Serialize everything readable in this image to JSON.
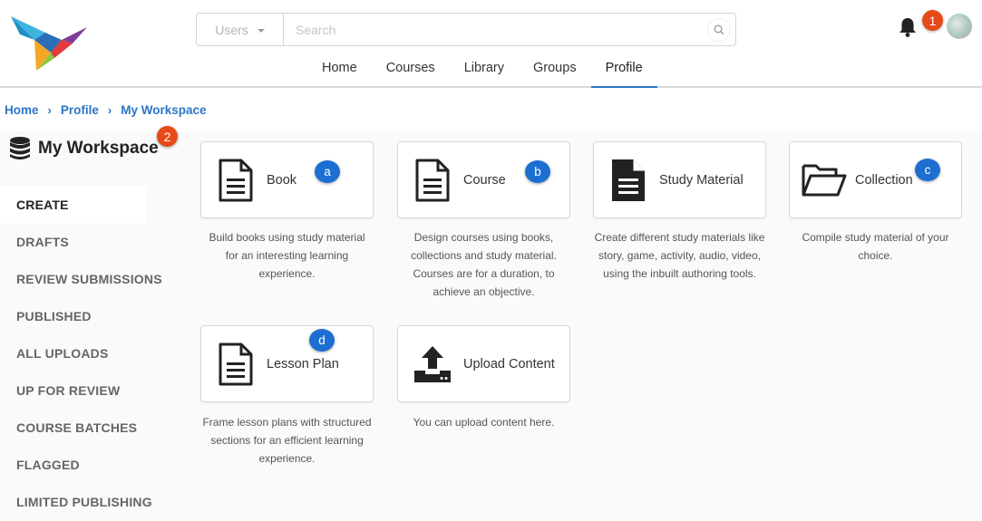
{
  "header": {
    "search_filter": "Users",
    "search_placeholder": "Search",
    "nav": [
      "Home",
      "Courses",
      "Library",
      "Groups",
      "Profile"
    ],
    "active_nav": "Profile",
    "notification_count_label": "1"
  },
  "breadcrumb": [
    "Home",
    "Profile",
    "My Workspace"
  ],
  "workspace": {
    "title": "My Workspace",
    "title_badge": "2",
    "menu": [
      "CREATE",
      "DRAFTS",
      "REVIEW SUBMISSIONS",
      "PUBLISHED",
      "ALL UPLOADS",
      "UP FOR REVIEW",
      "COURSE BATCHES",
      "FLAGGED",
      "LIMITED PUBLISHING"
    ],
    "active_menu": "CREATE"
  },
  "cards": [
    {
      "label": "Book",
      "badge": "a",
      "icon": "document-outline-icon",
      "desc": [
        "Build books using study material",
        "for an interesting learning",
        "experience."
      ]
    },
    {
      "label": "Course",
      "badge": "b",
      "icon": "document-outline-icon",
      "desc": [
        "Design courses using books,",
        "collections and study material.",
        "Courses are for a duration, to",
        "achieve an objective."
      ]
    },
    {
      "label": "Study Material",
      "badge": "",
      "icon": "document-filled-icon",
      "desc": [
        "Create different study materials like",
        "story, game, activity, audio, video,",
        "using the inbuilt authoring tools."
      ]
    },
    {
      "label": "Collection",
      "badge": "c",
      "icon": "folder-open-icon",
      "desc": [
        "Compile study material of your",
        "choice."
      ]
    },
    {
      "label": "Lesson Plan",
      "badge": "d",
      "icon": "document-outline-icon",
      "desc": [
        "Frame lesson plans with structured",
        "sections for an efficient learning",
        "experience."
      ]
    },
    {
      "label": "Upload Content",
      "badge": "",
      "icon": "upload-icon",
      "desc": [
        "You can upload content here."
      ]
    }
  ],
  "colors": {
    "accent": "#2b75c7",
    "badge_blue": "#1c6fd1",
    "badge_orange": "#e64a19"
  }
}
